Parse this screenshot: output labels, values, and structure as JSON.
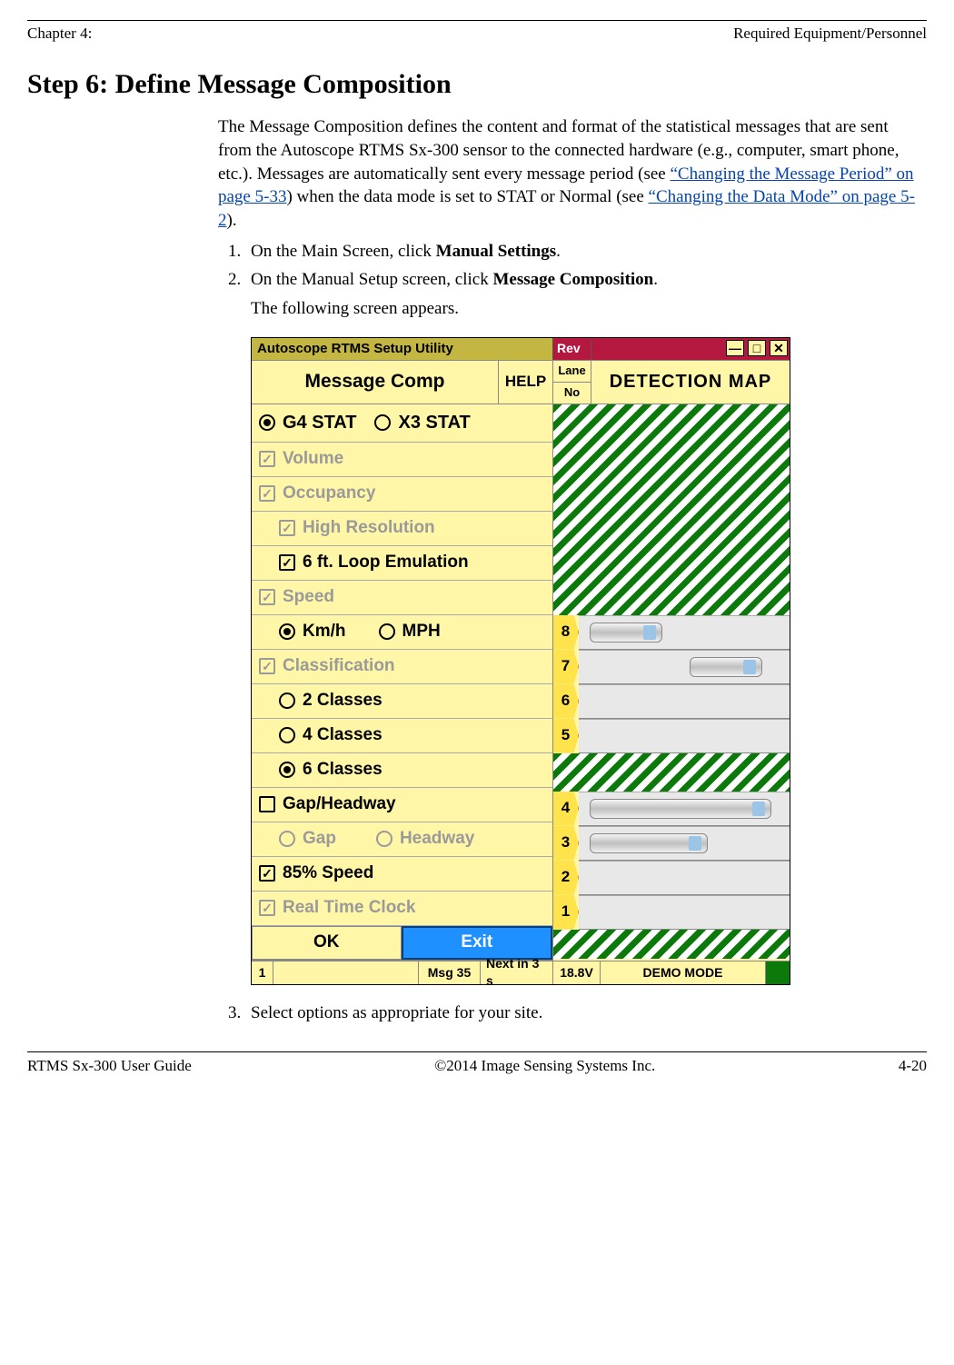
{
  "header": {
    "left": "Chapter 4:",
    "right": "Required Equipment/Personnel"
  },
  "step_title": "Step 6:  Define Message Composition",
  "intro": {
    "pre": "The Message Composition defines the content and format of the statistical messages that are sent from the Autoscope RTMS Sx-300 sensor to the connected hardware (e.g., computer, smart phone, etc.). Messages are automatically sent every message period (see ",
    "link1": "“Changing the Message Period” on page 5-33",
    "mid": ") when the data mode is set to STAT or Normal (see ",
    "link2": "“Changing the Data Mode” on page 5-2",
    "post": ")."
  },
  "steps": {
    "s1_pre": "On the Main Screen, click ",
    "s1_bold": "Manual Settings",
    "s1_post": ".",
    "s2_pre": "On the Manual Setup screen, click ",
    "s2_bold": "Message Composition",
    "s2_post": ".",
    "s2_follow": "The following screen appears.",
    "s3": "Select options as appropriate for your site."
  },
  "app": {
    "title": "Autoscope RTMS Setup Utility",
    "rev": "Rev",
    "header_label": "Message Comp",
    "help": "HELP",
    "lane": "Lane",
    "no": "No",
    "detmap": "DETECTION MAP",
    "opts": {
      "g4": "G4 STAT",
      "x3": "X3 STAT",
      "volume": "Volume",
      "occupancy": "Occupancy",
      "highres": "High Resolution",
      "loop": "6 ft. Loop Emulation",
      "speed": "Speed",
      "kmh": "Km/h",
      "mph": "MPH",
      "classification": "Classification",
      "c2": "2 Classes",
      "c4": "4 Classes",
      "c6": "6 Classes",
      "gaphead": "Gap/Headway",
      "gap": "Gap",
      "headway": "Headway",
      "p85": "85% Speed",
      "rtc": "Real Time Clock"
    },
    "ok": "OK",
    "exit": "Exit",
    "lanes": [
      "8",
      "7",
      "6",
      "5",
      "4",
      "3",
      "2",
      "1"
    ],
    "status": {
      "num": "1",
      "msg": "Msg 35",
      "next": "Next in 3 s",
      "volt": "18.8V",
      "mode": "DEMO MODE"
    }
  },
  "footer": {
    "left": "RTMS Sx-300 User Guide",
    "center": "©2014 Image Sensing Systems Inc.",
    "right": "4-20"
  }
}
